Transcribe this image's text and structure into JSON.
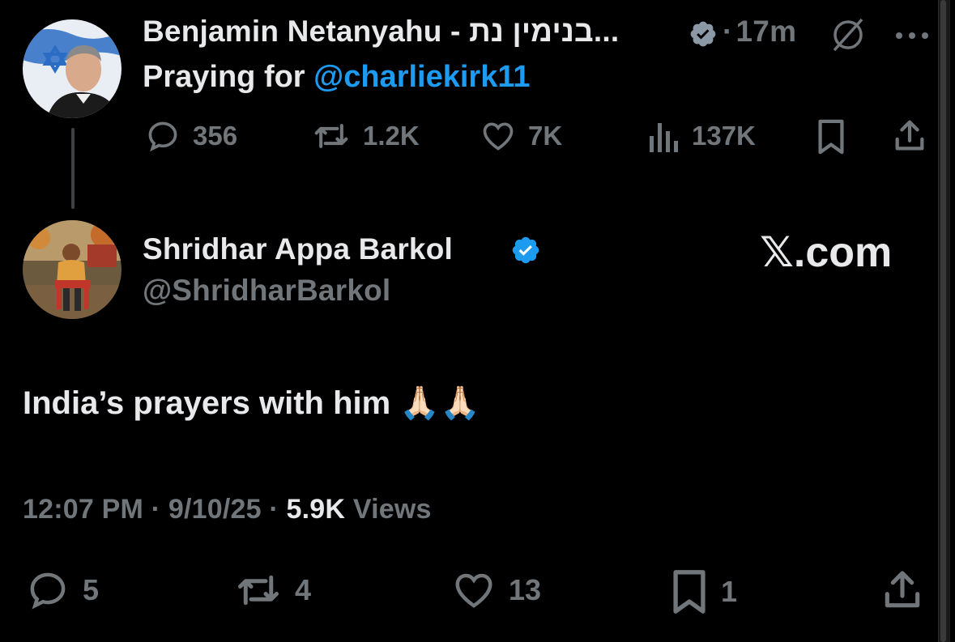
{
  "top_post": {
    "display_name": "Benjamin Netanyahu - בנימין נת...",
    "time": "17m",
    "dot": "·",
    "text_prefix": "Praying for ",
    "mention": "@charliekirk11",
    "metrics": {
      "replies": "356",
      "reposts": "1.2K",
      "likes": "7K",
      "views": "137K"
    }
  },
  "reply_post": {
    "display_name": "Shridhar Appa Barkol",
    "handle": "@ShridharBarkol",
    "brand": "𝕏.com",
    "text": "India’s prayers with him 🙏🏻🙏🏻",
    "timestamp": "12:07 PM",
    "date": "9/10/25",
    "dot": "·",
    "views_count": "5.9K",
    "views_label": "Views",
    "metrics": {
      "replies": "5",
      "reposts": "4",
      "likes": "13",
      "bookmarks": "1"
    }
  },
  "colors": {
    "background": "#000000",
    "text": "#e7e9ea",
    "muted": "#71767b",
    "accent": "#1d9bf0"
  },
  "icons": [
    "reply-icon",
    "repost-icon",
    "like-icon",
    "views-icon",
    "bookmark-icon",
    "share-icon",
    "grok-icon",
    "more-icon",
    "verified-icon"
  ]
}
